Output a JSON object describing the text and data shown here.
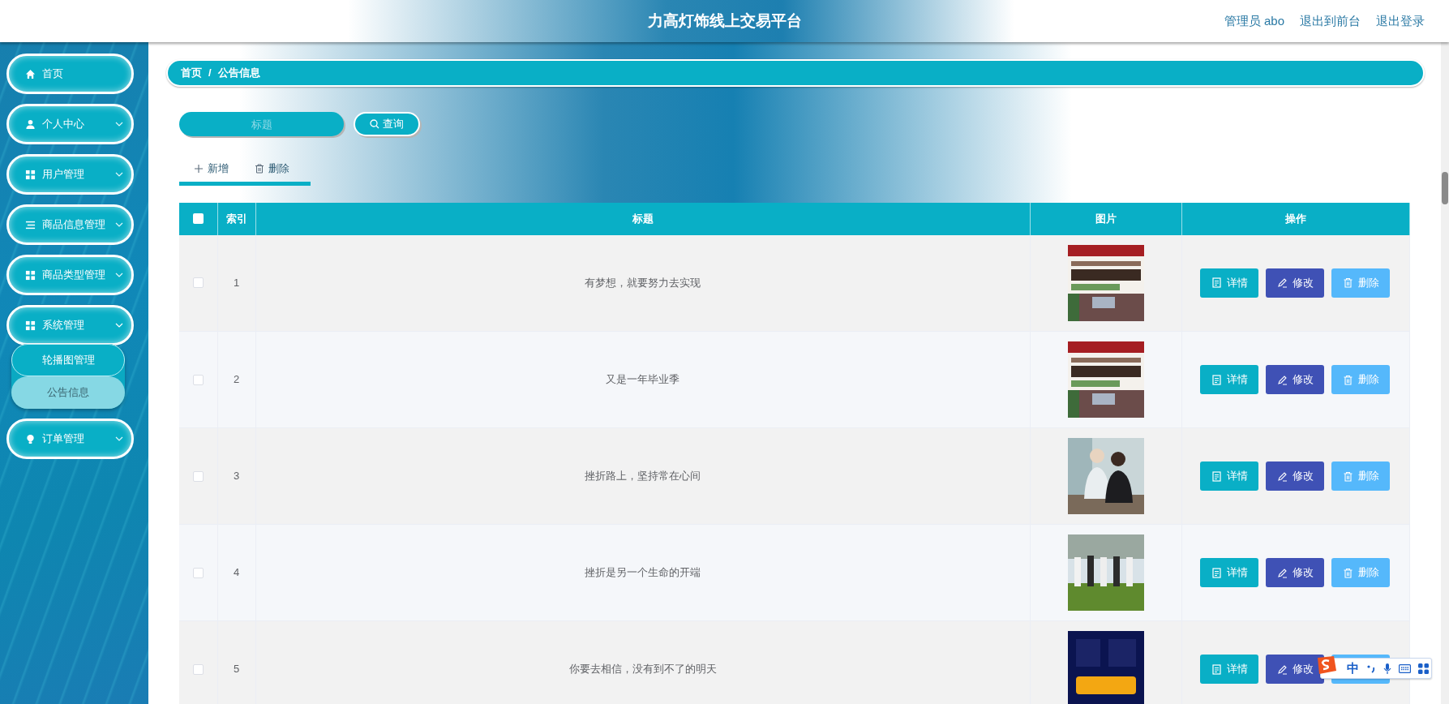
{
  "header": {
    "title": "力高灯饰线上交易平台",
    "links": [
      "管理员 abo",
      "退出到前台",
      "退出登录"
    ]
  },
  "sidebar": {
    "items": [
      {
        "label": "首页",
        "kind": "home",
        "expanded": false,
        "has_caret": false
      },
      {
        "label": "个人中心",
        "kind": "user",
        "expanded": false,
        "has_caret": true
      },
      {
        "label": "用户管理",
        "kind": "grid",
        "expanded": false,
        "has_caret": true
      },
      {
        "label": "商品信息管理",
        "kind": "list",
        "expanded": false,
        "has_caret": true
      },
      {
        "label": "商品类型管理",
        "kind": "grid",
        "expanded": false,
        "has_caret": true
      },
      {
        "label": "系统管理",
        "kind": "grid",
        "expanded": true,
        "has_caret": true,
        "children": [
          {
            "label": "轮播图管理",
            "selected": false
          },
          {
            "label": "公告信息",
            "selected": true
          }
        ]
      },
      {
        "label": "订单管理",
        "kind": "bulb",
        "expanded": false,
        "has_caret": true
      }
    ]
  },
  "breadcrumb": [
    "首页",
    "/",
    "公告信息"
  ],
  "search": {
    "placeholder": "标题",
    "button": "查询"
  },
  "toolbar": [
    {
      "label": "新增",
      "kind": "add"
    },
    {
      "label": "删除",
      "kind": "delete"
    }
  ],
  "table": {
    "select_all": {
      "checked": false
    },
    "columns": [
      "索引",
      "标题",
      "图片",
      "操作"
    ],
    "rows": [
      {
        "checked": false,
        "index": "1",
        "title": "有梦想，就要努力去实现",
        "image": {
          "kind": "picture"
        },
        "actions": [
          {
            "kind": "detail",
            "label": "详情"
          },
          {
            "kind": "edit",
            "label": "修改"
          },
          {
            "kind": "delete",
            "label": "删除"
          }
        ]
      },
      {
        "checked": false,
        "index": "2",
        "title": "又是一年毕业季",
        "image": {
          "kind": "picture"
        },
        "actions": [
          {
            "kind": "detail",
            "label": "详情"
          },
          {
            "kind": "edit",
            "label": "修改"
          },
          {
            "kind": "delete",
            "label": "删除"
          }
        ]
      },
      {
        "checked": false,
        "index": "3",
        "title": "挫折路上，坚持常在心间",
        "image": {
          "kind": "picture"
        },
        "actions": [
          {
            "kind": "detail",
            "label": "详情"
          },
          {
            "kind": "edit",
            "label": "修改"
          },
          {
            "kind": "delete",
            "label": "删除"
          }
        ]
      },
      {
        "checked": false,
        "index": "4",
        "title": "挫折是另一个生命的开端",
        "image": {
          "kind": "picture"
        },
        "actions": [
          {
            "kind": "detail",
            "label": "详情"
          },
          {
            "kind": "edit",
            "label": "修改"
          },
          {
            "kind": "delete",
            "label": "删除"
          }
        ]
      },
      {
        "checked": false,
        "index": "5",
        "title": "你要去相信，没有到不了的明天",
        "image": {
          "kind": "picture"
        },
        "actions": [
          {
            "kind": "detail",
            "label": "详情"
          },
          {
            "kind": "edit",
            "label": "修改"
          },
          {
            "kind": "delete"
          }
        ]
      }
    ]
  },
  "ime_toolbar": {
    "mode": "中"
  }
}
